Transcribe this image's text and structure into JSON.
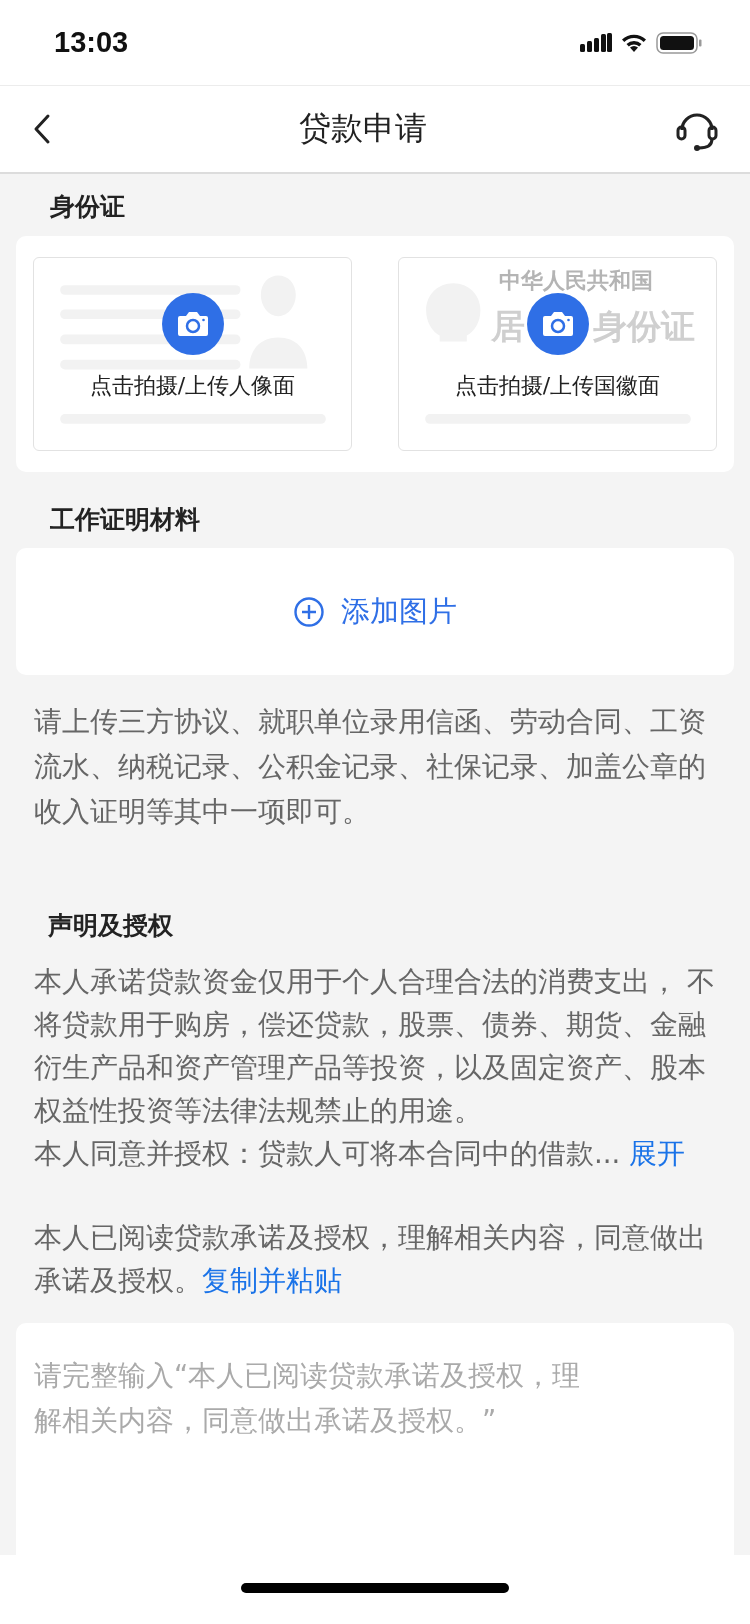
{
  "status_bar": {
    "time": "13:03"
  },
  "nav": {
    "title": "贷款申请"
  },
  "id_section": {
    "title": "身份证",
    "cards": [
      {
        "kind": "portrait",
        "label": "点击拍摄/上传人像面"
      },
      {
        "kind": "emblem",
        "label": "点击拍摄/上传国徽面",
        "card_texts": [
          "中华人民共和国",
          "居",
          "身份证"
        ]
      }
    ]
  },
  "work_section": {
    "title": "工作证明材料",
    "add_label": "添加图片",
    "hint": "请上传三方协议、就职单位录用信函、劳动合同、工资流水、纳税记录、公积金记录、社保记录、加盖公章的收入证明等其中一项即可。"
  },
  "declaration": {
    "title": "声明及授权",
    "body": "本人承诺贷款资金仅用于个人合理合法的消费支出， 不将贷款用于购房，偿还贷款，股票、债券、期货、金融衍生产品和资产管理产品等投资，以及固定资产、股本权益性投资等法律法规禁止的用途。",
    "summary": "本人同意并授权：贷款人可将本合同中的借款...",
    "expand_link": "展开",
    "confirm_text": "本人已阅读贷款承诺及授权，理解相关内容，同意做出承诺及授权。",
    "copy_link": "复制并粘贴"
  },
  "input": {
    "placeholder": "请完整输入“本人已阅读贷款承诺及授权，理解相关内容，同意做出承诺及授权。”"
  }
}
